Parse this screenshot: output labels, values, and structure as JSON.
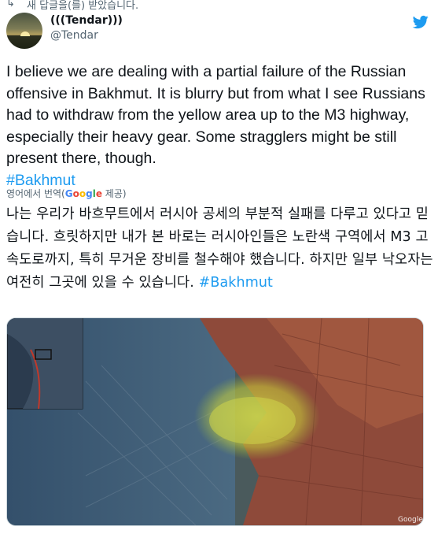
{
  "retweet_note": "새 답글을(를) 받았습니다.",
  "author": {
    "display_name": "(((Tendar)))",
    "handle": "@Tendar"
  },
  "tweet": {
    "text": "I believe we are dealing with a partial failure of the Russian offensive in Bakhmut. It is blurry but from what I see Russians had to withdraw from the yellow area up to the M3 highway, especially their heavy gear. Some stragglers might be still present there, though.",
    "hashtag": "#Bakhmut"
  },
  "translation": {
    "prefix": "영어에서 번역(",
    "google_parts": [
      "G",
      "o",
      "o",
      "g",
      "l",
      "e"
    ],
    "suffix": " 제공)",
    "text": "나는 우리가 바흐무트에서 러시아 공세의 부분적 실패를 다루고 있다고 믿습니다. 흐릿하지만 내가 본 바로는 러시아인들은 노란색 구역에서 M3 고속도로까지, 특히 무거운 장비를 철수해야 했습니다. 하지만 일부 낙오자는 여전히 그곳에 있을 수 있습니다.",
    "hashtag": "#Bakhmut"
  },
  "media": {
    "watermark": "Google"
  },
  "colors": {
    "link": "#1d9bf0",
    "brand": "#1d9bf0",
    "muted": "#536471"
  }
}
